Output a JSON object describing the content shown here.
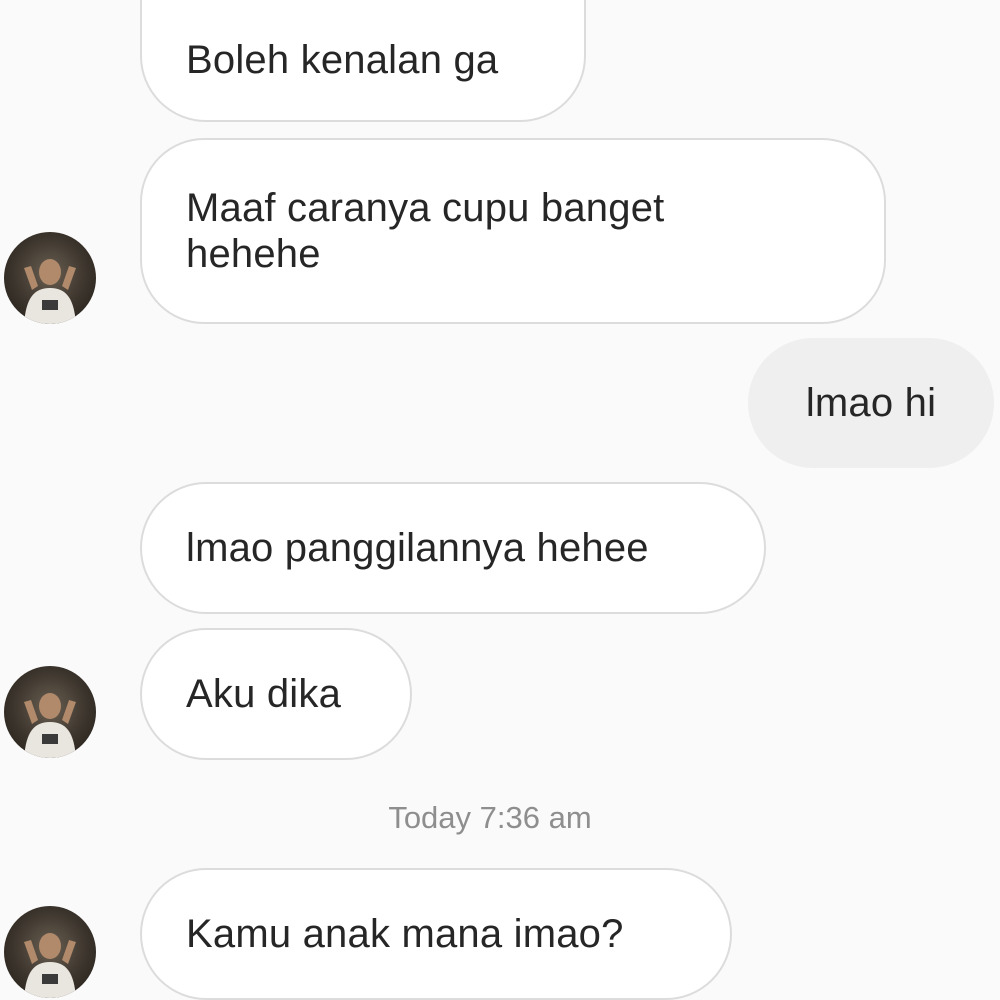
{
  "conversation": {
    "messages": [
      {
        "sender": "contact",
        "text": "Boleh kenalan ga"
      },
      {
        "sender": "contact",
        "lines": [
          "Maaf caranya cupu banget",
          "hehehe"
        ]
      },
      {
        "sender": "me",
        "text": "lmao hi"
      },
      {
        "sender": "contact",
        "text": "lmao panggilannya hehee"
      },
      {
        "sender": "contact",
        "text": "Aku dika"
      },
      {
        "sender": "contact",
        "text": "Kamu anak mana imao?"
      }
    ],
    "timestamp": "Today 7:36 am"
  },
  "colors": {
    "background": "#fafafa",
    "incoming_bubble": "#ffffff",
    "incoming_border": "#dcdcdc",
    "outgoing_bubble": "#efefef",
    "text": "#262626",
    "timestamp": "#8e8e8e"
  }
}
